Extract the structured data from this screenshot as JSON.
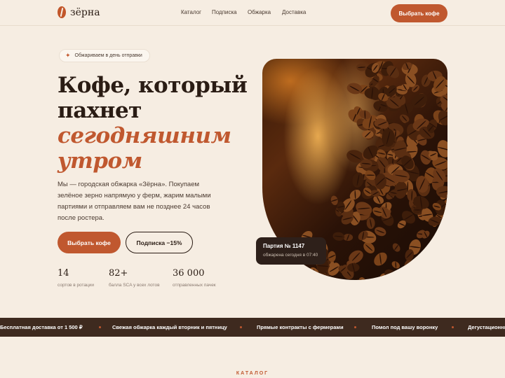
{
  "header": {
    "logo_text": "зёрна",
    "nav": [
      "Каталог",
      "Подписка",
      "Обжарка",
      "Доставка"
    ],
    "cta": "Выбрать кофе"
  },
  "hero": {
    "badge": "Обжариваем в день отправки",
    "title_lines": [
      "Кофе, который",
      "пахнет"
    ],
    "title_accent_lines": [
      "сегодняшним",
      "утром"
    ],
    "description": "Мы — городская обжарка «Зёрна». Покупаем зелёное зерно напрямую у ферм, жарим малыми партиями и отправляем вам не позднее 24 часов после ростера.",
    "primary_button": "Выбрать кофе",
    "secondary_button": "Подписка −15%",
    "stats": [
      {
        "value": "14",
        "label": "сортов в ротации"
      },
      {
        "value": "82+",
        "label": "балла SCA у всех лотов"
      },
      {
        "value": "36 000",
        "label": "отправленных пачек"
      }
    ],
    "batch": {
      "title": "Партия № 1147",
      "subtitle": "обжарена сегодня в 07:40"
    }
  },
  "ticker": [
    "Бесплатная доставка от 1 500 ₽",
    "Свежая обжарка каждый вторник и пятницу",
    "Прямые контракты с фермерами",
    "Помол под вашу воронку",
    "Дегустационные"
  ],
  "section_label": "КАТАЛОГ",
  "colors": {
    "accent": "#c0582f",
    "background": "#f6ede2",
    "dark": "#3e2a1f"
  },
  "icons": {
    "badge": "sparkle-icon",
    "logo": "coffee-bean-icon"
  }
}
